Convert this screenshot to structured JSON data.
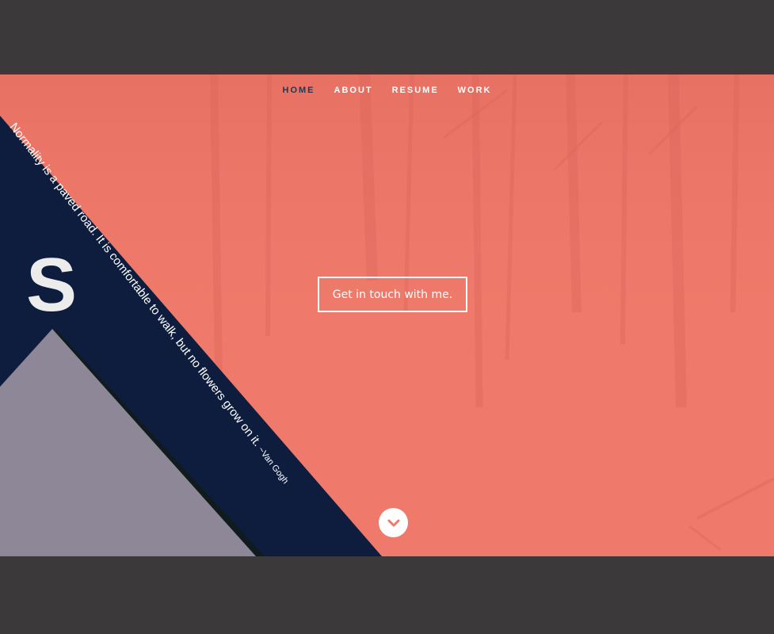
{
  "nav": {
    "items": [
      {
        "label": "HOME",
        "active": true
      },
      {
        "label": "ABOUT",
        "active": false
      },
      {
        "label": "RESUME",
        "active": false
      },
      {
        "label": "WORK",
        "active": false
      }
    ]
  },
  "hero": {
    "cta_label": "Get in touch with me.",
    "quote_text": "Normality is a paved road. It is comfortable to walk, but no flowers grow on it.",
    "quote_author": "~Van Gogh",
    "logo_letter": "S",
    "scroll_icon": "chevron-down-icon"
  },
  "colors": {
    "page_bg": "#3b393a",
    "hero_bg": "#ef7a6b",
    "navy": "#0e1d3d",
    "mauve": "#8d8797",
    "active_nav": "#2b3550"
  }
}
